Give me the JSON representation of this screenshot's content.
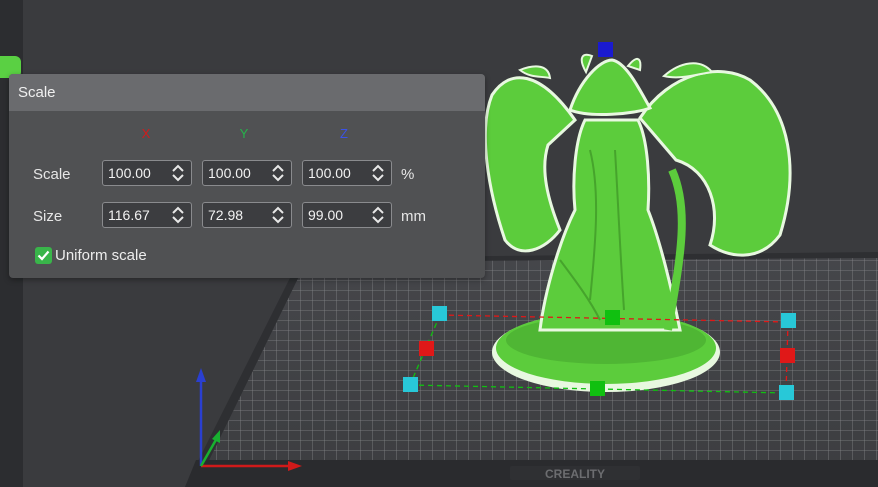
{
  "panel": {
    "title": "Scale",
    "axes": {
      "x": "X",
      "y": "Y",
      "z": "Z"
    },
    "scale_row": {
      "label": "Scale",
      "x": "100.00",
      "y": "100.00",
      "z": "100.00",
      "unit": "%"
    },
    "size_row": {
      "label": "Size",
      "x": "116.67",
      "y": "72.98",
      "z": "99.00",
      "unit": "mm"
    },
    "uniform_scale": {
      "label": "Uniform scale",
      "checked": true
    }
  },
  "scene": {
    "bed_brand": "CREALITY",
    "model_color": "#5ccc3c",
    "handle_colors": {
      "x": "#e01818",
      "y": "#10c010",
      "z": "#1a1ad0",
      "corner": "#28c8d8"
    }
  }
}
